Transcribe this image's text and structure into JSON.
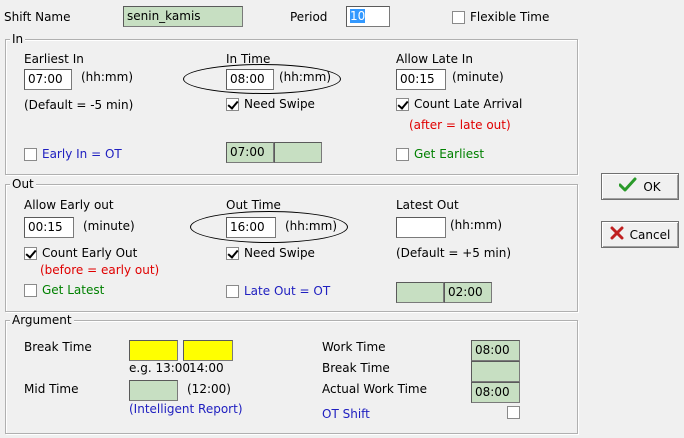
{
  "header": {
    "shift_name_label": "Shift Name",
    "shift_name_value": "senin_kamis",
    "period_label": "Period",
    "period_value": "10",
    "flexible_time_label": "Flexible Time"
  },
  "in_group": {
    "title": "In",
    "earliest_in_label": "Earliest In",
    "earliest_in_value": "07:00",
    "earliest_in_unit": "(hh:mm)",
    "earliest_in_default": "(Default = -5 min)",
    "in_time_label": "In Time",
    "in_time_value": "08:00",
    "in_time_unit": "(hh:mm)",
    "need_swipe_label": "Need Swipe",
    "allow_late_label": "Allow Late In",
    "allow_late_value": "00:15",
    "allow_late_unit": "(minute)",
    "count_late_label": "Count Late Arrival",
    "count_late_note": "(after = late out)",
    "early_in_ot_label": "Early In = OT",
    "in_display_value": "07:00",
    "get_earliest_label": "Get Earliest"
  },
  "out_group": {
    "title": "Out",
    "allow_early_label": "Allow Early out",
    "allow_early_value": "00:15",
    "allow_early_unit": "(minute)",
    "count_early_label": "Count Early Out",
    "count_early_note": "(before = early out)",
    "get_latest_label": "Get Latest",
    "out_time_label": "Out Time",
    "out_time_value": "16:00",
    "out_time_unit": "(hh:mm)",
    "need_swipe_label": "Need Swipe",
    "late_out_ot_label": "Late Out = OT",
    "latest_out_label": "Latest Out",
    "latest_out_value": "",
    "latest_out_unit": "(hh:mm)",
    "latest_out_default": "(Default = +5 min)",
    "out_display_value": "02:00"
  },
  "argument_group": {
    "title": "Argument",
    "break_time_label": "Break Time",
    "break_example_1": "e.g. 13:00",
    "break_example_2": "14:00",
    "mid_time_label": "Mid Time",
    "mid_time_hint": "(12:00)",
    "intelligent_report": "(Intelligent Report)",
    "work_time_label": "Work Time",
    "work_time_value": "08:00",
    "break_time_right_label": "Break Time",
    "actual_work_label": "Actual Work Time",
    "actual_work_value": "08:00",
    "ot_shift_label": "OT Shift"
  },
  "buttons": {
    "ok_label": "OK",
    "cancel_label": "Cancel"
  },
  "colors": {
    "field_green": "#c7dfc2",
    "field_yellow": "#ffff00",
    "link_blue": "#2020c0",
    "note_red": "#e00000",
    "text_green": "#008000"
  }
}
